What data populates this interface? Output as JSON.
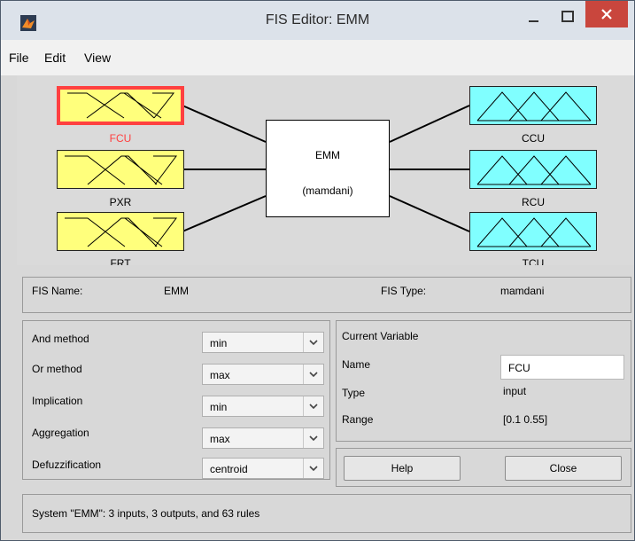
{
  "window": {
    "title": "FIS Editor: EMM"
  },
  "menu": [
    "File",
    "Edit",
    "View"
  ],
  "inputs": [
    {
      "label": "FCU",
      "selected": true
    },
    {
      "label": "PXR",
      "selected": false
    },
    {
      "label": "FRT",
      "selected": false
    }
  ],
  "outputs": [
    {
      "label": "CCU"
    },
    {
      "label": "RCU"
    },
    {
      "label": "TCU"
    }
  ],
  "system_box": {
    "name": "EMM",
    "type": "(mamdani)"
  },
  "fis": {
    "name_label": "FIS Name:",
    "name_value": "EMM",
    "type_label": "FIS Type:",
    "type_value": "mamdani"
  },
  "methods": [
    {
      "label": "And method",
      "value": "min"
    },
    {
      "label": "Or method",
      "value": "max"
    },
    {
      "label": "Implication",
      "value": "min"
    },
    {
      "label": "Aggregation",
      "value": "max"
    },
    {
      "label": "Defuzzification",
      "value": "centroid"
    }
  ],
  "current_variable": {
    "heading": "Current Variable",
    "name_label": "Name",
    "name_value": "FCU",
    "type_label": "Type",
    "type_value": "input",
    "range_label": "Range",
    "range_value": "[0.1 0.55]"
  },
  "buttons": {
    "help": "Help",
    "close": "Close"
  },
  "status": "System \"EMM\": 3 inputs, 3 outputs, and 63 rules",
  "colors": {
    "input_fill": "#ffff7c",
    "output_fill": "#80ffff",
    "selected_border": "#ff4040",
    "close_button": "#c9463d"
  }
}
